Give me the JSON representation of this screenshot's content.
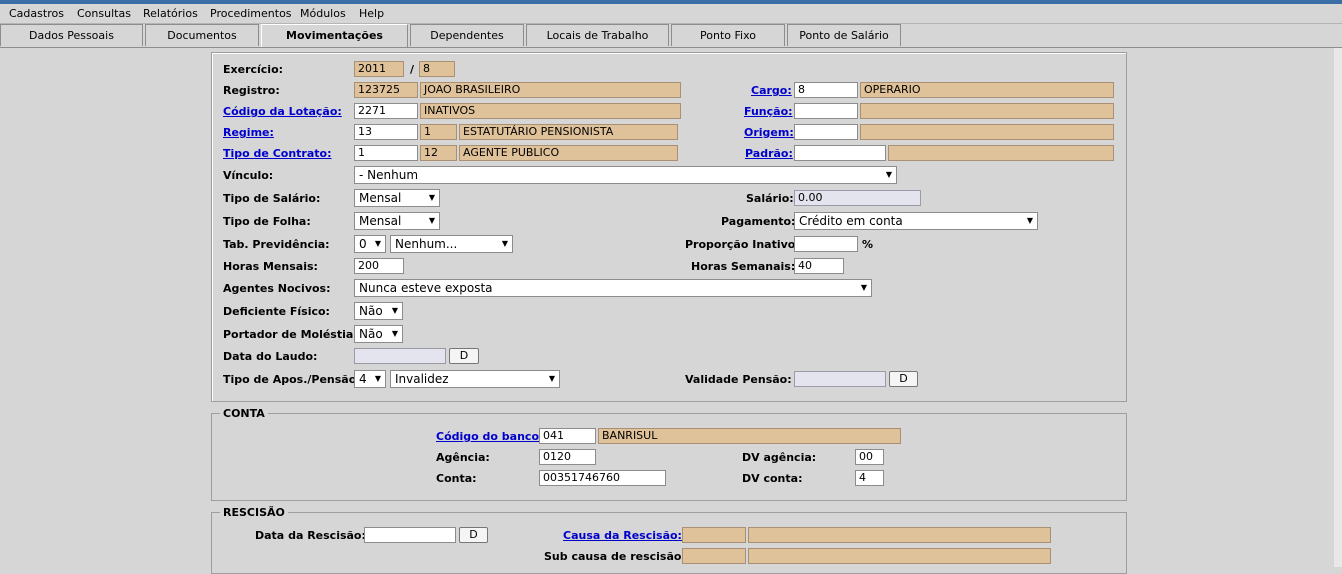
{
  "menu": [
    "Cadastros",
    "Consultas",
    "Relatórios",
    "Procedimentos",
    "Módulos",
    "Help"
  ],
  "tabs": [
    "Dados Pessoais",
    "Documentos",
    "Movimentações",
    "Dependentes",
    "Locais de Trabalho",
    "Ponto Fixo",
    "Ponto de Salário"
  ],
  "active_tab": "Movimentações",
  "form": {
    "exercicio_label": "Exercício:",
    "exercicio_ano": "2011",
    "exercicio_sep": "/",
    "exercicio_mes": "8",
    "registro_label": "Registro:",
    "registro_num": "123725",
    "registro_nome": "JOAO BRASILEIRO",
    "cargo_label": "Cargo:",
    "cargo_cod": "8",
    "cargo_desc": "OPERARIO",
    "lotacao_label": "Código da Lotação:",
    "lotacao_cod": "2271",
    "lotacao_desc": "INATIVOS",
    "funcao_label": "Função:",
    "funcao_cod": "",
    "funcao_desc": "",
    "regime_label": "Regime:",
    "regime_cod": "13",
    "regime_num": "1",
    "regime_desc": "ESTATUTÁRIO PENSIONISTA",
    "origem_label": "Origem:",
    "origem_cod": "",
    "origem_desc": "",
    "contrato_label": "Tipo de Contrato:",
    "contrato_cod": "1",
    "contrato_num": "12",
    "contrato_desc": "AGENTE PUBLICO",
    "padrao_label": "Padrão:",
    "padrao_cod": "",
    "padrao_desc": "",
    "vinculo_label": "Vínculo:",
    "vinculo_value": "- Nenhum",
    "tipo_salario_label": "Tipo de Salário:",
    "tipo_salario_value": "Mensal",
    "salario_label": "Salário:",
    "salario_value": "0.00",
    "tipo_folha_label": "Tipo de Folha:",
    "tipo_folha_value": "Mensal",
    "pagamento_label": "Pagamento:",
    "pagamento_value": "Crédito em conta",
    "tab_prev_label": "Tab. Previdência:",
    "tab_prev_num": "0",
    "tab_prev_value": "Nenhum...",
    "proporcao_label": "Proporção Inativo:",
    "proporcao_value": "",
    "proporcao_unit": "%",
    "horas_mensais_label": "Horas Mensais:",
    "horas_mensais_value": "200",
    "horas_semanais_label": "Horas Semanais:",
    "horas_semanais_value": "40",
    "agentes_label": "Agentes Nocivos:",
    "agentes_value": "Nunca esteve exposta",
    "deficiente_label": "Deficiente Físico:",
    "deficiente_value": "Não",
    "molestia_label": "Portador de Moléstia:",
    "molestia_value": "Não",
    "laudo_label": "Data do Laudo:",
    "laudo_value": "",
    "d_button": "D",
    "apos_label": "Tipo de Apos./Pensão:",
    "apos_num": "4",
    "apos_value": "Invalidez",
    "validade_label": "Validade Pensão:",
    "validade_value": ""
  },
  "conta": {
    "legend": "CONTA",
    "banco_label": "Código do banco:",
    "banco_cod": "041",
    "banco_nome": "BANRISUL",
    "agencia_label": "Agência:",
    "agencia_value": "0120",
    "dv_agencia_label": "DV agência:",
    "dv_agencia_value": "00",
    "conta_label": "Conta:",
    "conta_value": "00351746760",
    "dv_conta_label": "DV conta:",
    "dv_conta_value": "4"
  },
  "rescisao": {
    "legend": "RESCISÃO",
    "data_label": "Data da Rescisão:",
    "data_value": "",
    "d_button": "D",
    "causa_label": "Causa da Rescisão:",
    "causa_cod": "",
    "causa_desc": "",
    "subcausa_label": "Sub causa de rescisão:",
    "subcausa_cod": "",
    "subcausa_desc": ""
  }
}
